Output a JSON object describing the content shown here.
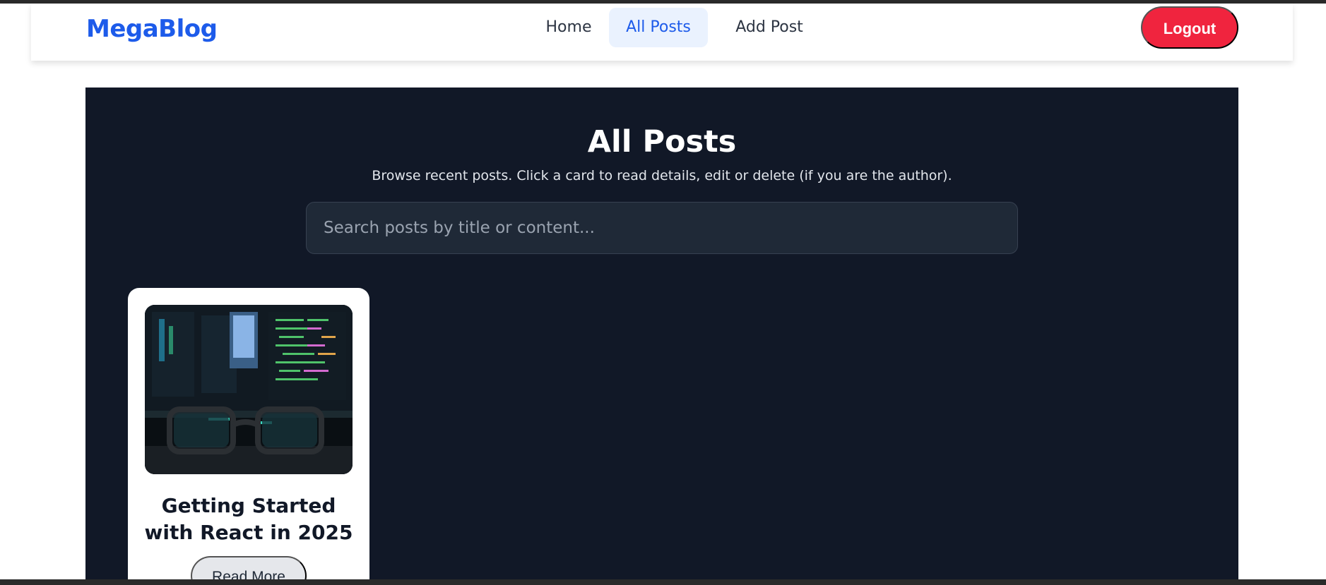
{
  "brand": {
    "logo_text": "MegaBlog",
    "accent_color": "#1d5bea",
    "danger_color": "#f0243e"
  },
  "nav": {
    "items": [
      {
        "label": "Home",
        "active": false
      },
      {
        "label": "All Posts",
        "active": true
      },
      {
        "label": "Add Post",
        "active": false
      }
    ],
    "logout_label": "Logout"
  },
  "page": {
    "title": "All Posts",
    "subtitle": "Browse recent posts. Click a card to read details, edit or delete (if you are the author)."
  },
  "search": {
    "placeholder": "Search posts by title or content...",
    "value": ""
  },
  "posts": [
    {
      "title": "Getting Started with React in 2025",
      "image_icon": "code-screen-with-glasses-image",
      "button_label": "Read More"
    }
  ]
}
